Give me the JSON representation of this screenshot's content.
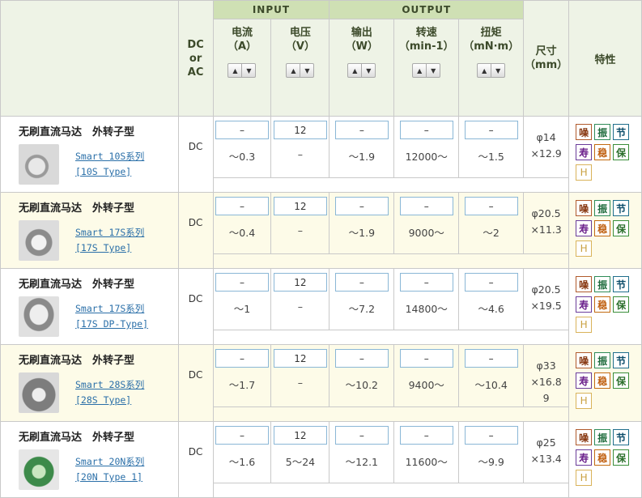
{
  "header": {
    "dc_or_ac": [
      "DC",
      "or",
      "AC"
    ],
    "input_group": "INPUT",
    "output_group": "OUTPUT",
    "cols": [
      {
        "line1": "电流",
        "line2": "（A）"
      },
      {
        "line1": "电压",
        "line2": "（V）"
      },
      {
        "line1": "输出",
        "line2": "（W）"
      },
      {
        "line1": "转速",
        "line2": "（min-1）"
      },
      {
        "line1": "扭矩",
        "line2": "（mN·m）"
      }
    ],
    "size": {
      "line1": "尺寸",
      "line2": "（mm）"
    },
    "features": "特性",
    "sort_up": "▲",
    "sort_down": "▼"
  },
  "feature_badges": [
    "噪",
    "振",
    "节",
    "寿",
    "稳",
    "保",
    "H"
  ],
  "products": [
    {
      "name": "无刷直流马达　外转子型",
      "link1": "Smart 10S系列",
      "link2": "[10S Type]",
      "dc": "DC",
      "boxes": [
        "–",
        "12",
        "–",
        "–",
        "–"
      ],
      "vals": [
        "～0.3",
        "–",
        "～1.9",
        "12000～",
        "～1.5"
      ],
      "size1": "φ14",
      "size2": "×12.9",
      "size3": ""
    },
    {
      "name": "无刷直流马达　外转子型",
      "link1": "Smart 17S系列",
      "link2": "[17S Type]",
      "dc": "DC",
      "boxes": [
        "–",
        "12",
        "–",
        "–",
        "–"
      ],
      "vals": [
        "～0.4",
        "–",
        "～1.9",
        "9000～",
        "～2"
      ],
      "size1": "φ20.5",
      "size2": "×11.3",
      "size3": ""
    },
    {
      "name": "无刷直流马达　外转子型",
      "link1": "Smart 17S系列",
      "link2": "[17S DP-Type]",
      "dc": "DC",
      "boxes": [
        "–",
        "12",
        "–",
        "–",
        "–"
      ],
      "vals": [
        "～1",
        "–",
        "～7.2",
        "14800～",
        "～4.6"
      ],
      "size1": "φ20.5",
      "size2": "×19.5",
      "size3": ""
    },
    {
      "name": "无刷直流马达　外转子型",
      "link1": "Smart 28S系列",
      "link2": "[28S Type]",
      "dc": "DC",
      "boxes": [
        "–",
        "12",
        "–",
        "–",
        "–"
      ],
      "vals": [
        "～1.7",
        "–",
        "～10.2",
        "9400～",
        "～10.4"
      ],
      "size1": "φ33",
      "size2": "×16.8",
      "size3": "9"
    },
    {
      "name": "无刷直流马达　外转子型",
      "link1": "Smart 20N系列",
      "link2": "[20N Type 1]",
      "dc": "DC",
      "boxes": [
        "–",
        "12",
        "–",
        "–",
        "–"
      ],
      "vals": [
        "～1.6",
        "5～24",
        "～12.1",
        "11600～",
        "～9.9"
      ],
      "size1": "φ25",
      "size2": "×13.4",
      "size3": ""
    }
  ]
}
